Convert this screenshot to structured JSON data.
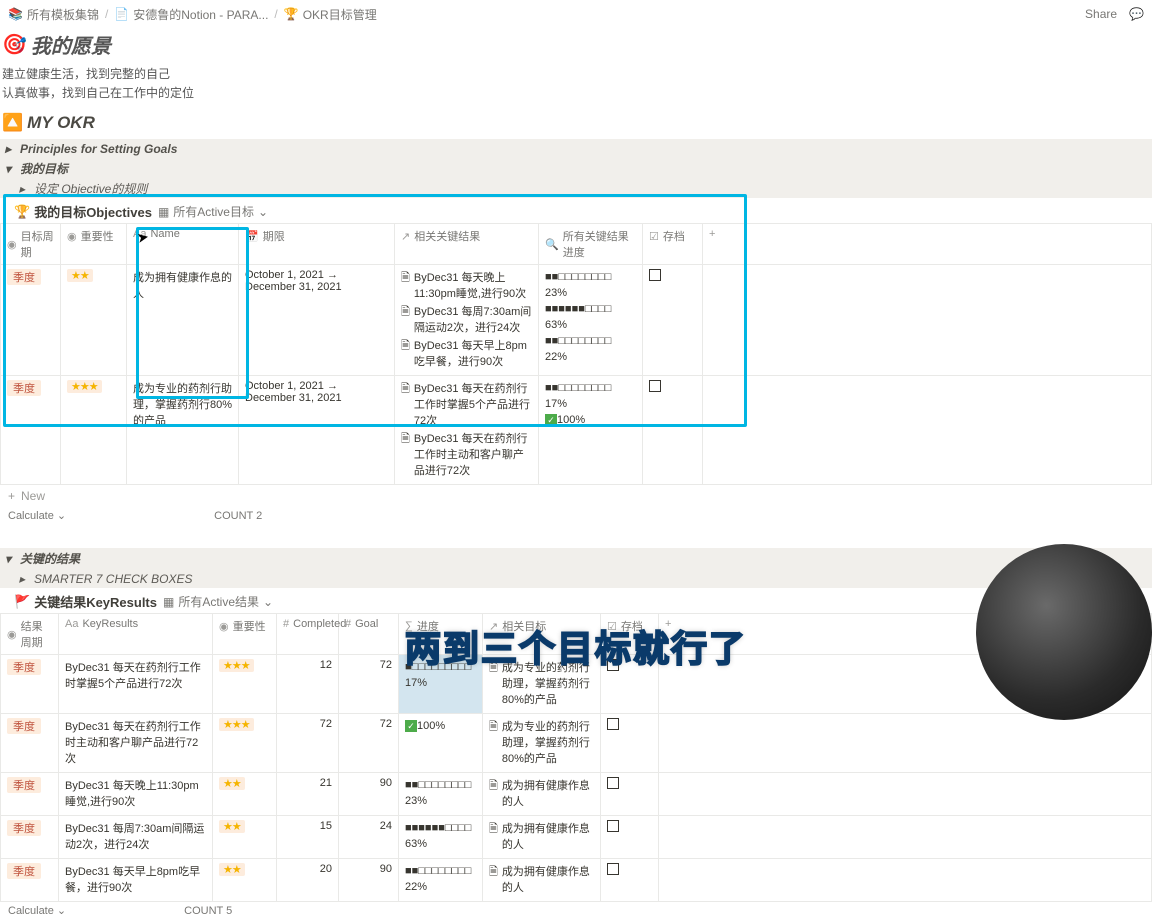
{
  "breadcrumb": {
    "items": [
      {
        "icon": "📋",
        "label": "所有模板集锦"
      },
      {
        "icon": "📄",
        "label": "安德鲁的Notion - PARA..."
      },
      {
        "icon": "🏆",
        "label": "OKR目标管理"
      }
    ]
  },
  "topbar": {
    "share": "Share"
  },
  "vision": {
    "title": "我的愿景",
    "line1": "建立健康生活，找到完整的自己",
    "line2": "认真做事，找到自己在工作中的定位"
  },
  "okr": {
    "title": "MY OKR",
    "principles": "Principles for Setting Goals",
    "my_goals": "我的目标",
    "setting_rule": "设定 Objective的规则",
    "smarter": "SMARTER 7 CHECK BOXES",
    "results": "关键的结果"
  },
  "obj_db": {
    "title": "我的目标Objectives",
    "view": "所有Active目标",
    "columns": {
      "period": "目标周期",
      "importance": "重要性",
      "name": "Name",
      "deadline": "期限",
      "related": "相关关键结果",
      "progress": "所有关键结果进度",
      "archive": "存档"
    },
    "rows": [
      {
        "period": "季度",
        "stars": "★★",
        "name": "成为拥有健康作息的人",
        "deadline": "October 1, 2021 → December 31, 2021",
        "kr": [
          "ByDec31 每天晚上11:30pm睡觉,进行90次",
          "ByDec31 每周7:30am间隔运动2次，进行24次",
          "ByDec31 每天早上8pm吃早餐，进行90次"
        ],
        "progress": [
          "■■□□□□□□□□ 23%",
          "■■■■■■□□□□ 63%",
          "■■□□□□□□□□ 22%"
        ]
      },
      {
        "period": "季度",
        "stars": "★★★",
        "name": "成为专业的药剂行助理，掌握药剂行80%的产品",
        "deadline": "October 1, 2021 → December 31, 2021",
        "kr": [
          "ByDec31 每天在药剂行工作时掌握5个产品进行72次",
          "ByDec31 每天在药剂行工作时主动和客户聊产品进行72次"
        ],
        "progress": [
          "■■□□□□□□□□ 17%",
          "✓100%"
        ]
      }
    ],
    "new": "New",
    "calculate": "Calculate",
    "count": "COUNT",
    "count_val": "2"
  },
  "kr_db": {
    "title": "关键结果KeyResults",
    "view": "所有Active结果",
    "columns": {
      "period": "结果周期",
      "kr": "KeyResults",
      "importance": "重要性",
      "completed": "Completed",
      "goal": "Goal",
      "progress": "进度",
      "related": "相关目标",
      "archive": "存档"
    },
    "rows": [
      {
        "period": "季度",
        "kr": "ByDec31 每天在药剂行工作时掌握5个产品进行72次",
        "stars": "★★★",
        "completed": "12",
        "goal": "72",
        "progress": "■□□□□□□□□□",
        "pct": "17%",
        "related": "成为专业的药剂行助理，掌握药剂行80%的产品"
      },
      {
        "period": "季度",
        "kr": "ByDec31 每天在药剂行工作时主动和客户聊产品进行72次",
        "stars": "★★★",
        "completed": "72",
        "goal": "72",
        "progress": "✓",
        "pct": "100%",
        "related": "成为专业的药剂行助理，掌握药剂行80%的产品"
      },
      {
        "period": "季度",
        "kr": "ByDec31 每天晚上11:30pm睡觉,进行90次",
        "stars": "★★",
        "completed": "21",
        "goal": "90",
        "progress": "■■□□□□□□□□",
        "pct": "23%",
        "related": "成为拥有健康作息的人"
      },
      {
        "period": "季度",
        "kr": "ByDec31 每周7:30am间隔运动2次，进行24次",
        "stars": "★★",
        "completed": "15",
        "goal": "24",
        "progress": "■■■■■■□□□□",
        "pct": "63%",
        "related": "成为拥有健康作息的人"
      },
      {
        "period": "季度",
        "kr": "ByDec31 每天早上8pm吃早餐，进行90次",
        "stars": "★★",
        "completed": "20",
        "goal": "90",
        "progress": "■■□□□□□□□□",
        "pct": "22%",
        "related": "成为拥有健康作息的人"
      }
    ],
    "calculate": "Calculate",
    "count": "COUNT",
    "count_val": "5"
  },
  "caption": "两到三个目标就行了"
}
